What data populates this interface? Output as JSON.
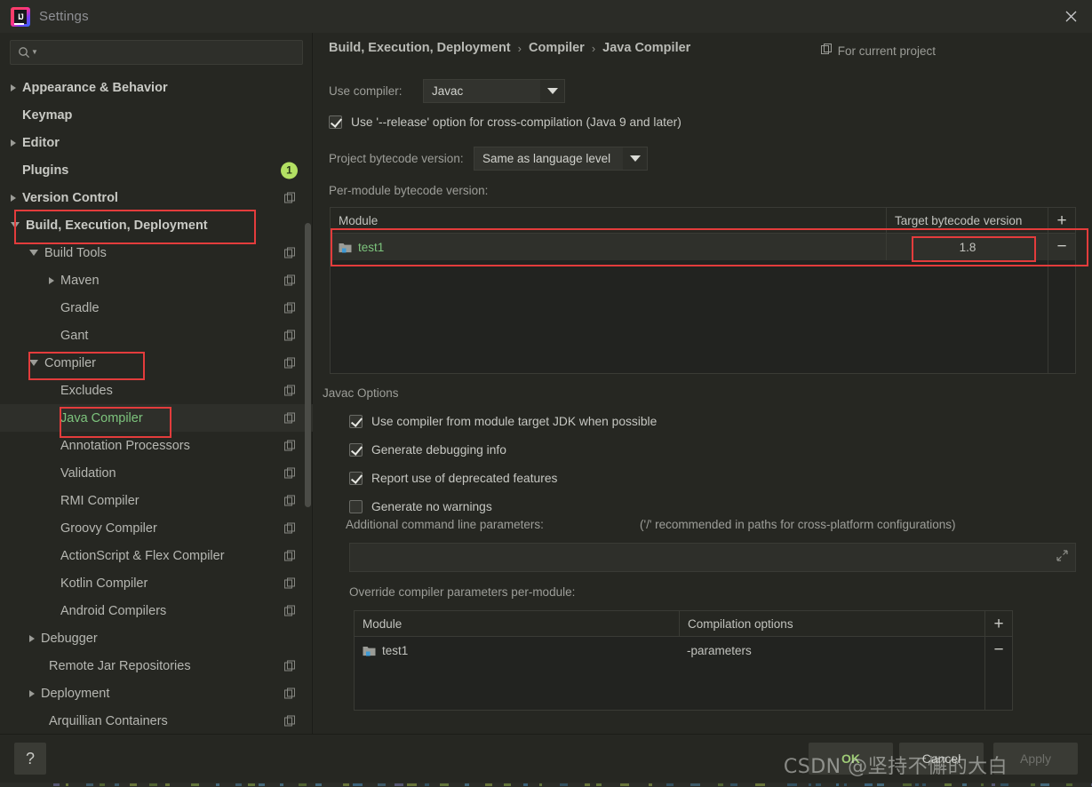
{
  "window": {
    "title": "Settings",
    "logo_text": "IJ",
    "close_icon": "close-icon"
  },
  "search": {
    "value": "",
    "placeholder": ""
  },
  "sidebar": {
    "items": [
      {
        "label": "Appearance & Behavior",
        "indent": 12,
        "twisty": "collapsed",
        "bold": true,
        "icon": "none",
        "selected": false
      },
      {
        "label": "Keymap",
        "indent": 25,
        "twisty": "none",
        "bold": true,
        "icon": "none",
        "selected": false
      },
      {
        "label": "Editor",
        "indent": 12,
        "twisty": "collapsed",
        "bold": true,
        "icon": "none",
        "selected": false
      },
      {
        "label": "Plugins",
        "indent": 25,
        "twisty": "none",
        "bold": true,
        "icon": "badge",
        "badge": "1",
        "selected": false
      },
      {
        "label": "Version Control",
        "indent": 12,
        "twisty": "collapsed",
        "bold": true,
        "icon": "copy-icon",
        "selected": false
      },
      {
        "label": "Build, Execution, Deployment",
        "indent": 12,
        "twisty": "expanded",
        "bold": true,
        "icon": "none",
        "selected": false
      },
      {
        "label": "Build Tools",
        "indent": 33,
        "twisty": "expanded",
        "bold": false,
        "icon": "copy-icon",
        "selected": false
      },
      {
        "label": "Maven",
        "indent": 55,
        "twisty": "collapsed",
        "bold": false,
        "icon": "copy-icon",
        "selected": false
      },
      {
        "label": "Gradle",
        "indent": 68,
        "twisty": "none",
        "bold": false,
        "icon": "copy-icon",
        "selected": false
      },
      {
        "label": "Gant",
        "indent": 68,
        "twisty": "none",
        "bold": false,
        "icon": "copy-icon",
        "selected": false
      },
      {
        "label": "Compiler",
        "indent": 33,
        "twisty": "expanded",
        "bold": false,
        "icon": "copy-icon",
        "selected": false
      },
      {
        "label": "Excludes",
        "indent": 68,
        "twisty": "none",
        "bold": false,
        "icon": "copy-icon",
        "selected": false
      },
      {
        "label": "Java Compiler",
        "indent": 68,
        "twisty": "none",
        "bold": false,
        "icon": "copy-icon",
        "selected": true,
        "green": true
      },
      {
        "label": "Annotation Processors",
        "indent": 68,
        "twisty": "none",
        "bold": false,
        "icon": "copy-icon",
        "selected": false
      },
      {
        "label": "Validation",
        "indent": 68,
        "twisty": "none",
        "bold": false,
        "icon": "copy-icon",
        "selected": false
      },
      {
        "label": "RMI Compiler",
        "indent": 68,
        "twisty": "none",
        "bold": false,
        "icon": "copy-icon",
        "selected": false
      },
      {
        "label": "Groovy Compiler",
        "indent": 68,
        "twisty": "none",
        "bold": false,
        "icon": "copy-icon",
        "selected": false
      },
      {
        "label": "ActionScript & Flex Compiler",
        "indent": 68,
        "twisty": "none",
        "bold": false,
        "icon": "copy-icon",
        "selected": false
      },
      {
        "label": "Kotlin Compiler",
        "indent": 68,
        "twisty": "none",
        "bold": false,
        "icon": "copy-icon",
        "selected": false
      },
      {
        "label": "Android Compilers",
        "indent": 68,
        "twisty": "none",
        "bold": false,
        "icon": "copy-icon",
        "selected": false
      },
      {
        "label": "Debugger",
        "indent": 33,
        "twisty": "collapsed",
        "bold": false,
        "icon": "none",
        "selected": false
      },
      {
        "label": "Remote Jar Repositories",
        "indent": 55,
        "twisty": "none",
        "bold": false,
        "icon": "copy-icon",
        "selected": false
      },
      {
        "label": "Deployment",
        "indent": 33,
        "twisty": "collapsed",
        "bold": false,
        "icon": "copy-icon",
        "selected": false
      },
      {
        "label": "Arquillian Containers",
        "indent": 55,
        "twisty": "none",
        "bold": false,
        "icon": "copy-icon",
        "selected": false
      }
    ]
  },
  "header": {
    "breadcrumb": [
      "Build, Execution, Deployment",
      "Compiler",
      "Java Compiler"
    ],
    "separator": "›",
    "for_project_label": "For current project"
  },
  "compiler": {
    "use_compiler_label": "Use compiler:",
    "use_compiler_value": "Javac",
    "release_option_label": "Use '--release' option for cross-compilation (Java 9 and later)",
    "release_option_checked": true,
    "project_bytecode_label": "Project bytecode version:",
    "project_bytecode_value": "Same as language level",
    "per_module_label": "Per-module bytecode version:"
  },
  "bytecode_table": {
    "columns": [
      "Module",
      "Target bytecode version"
    ],
    "rows": [
      {
        "module": "test1",
        "target": "1.8",
        "selected": true
      }
    ],
    "add_label": "+",
    "remove_label": "−"
  },
  "javac": {
    "section_title": "Javac Options",
    "options": [
      {
        "label": "Use compiler from module target JDK when possible",
        "checked": true
      },
      {
        "label": "Generate debugging info",
        "checked": true
      },
      {
        "label": "Report use of deprecated features",
        "checked": true
      },
      {
        "label": "Generate no warnings",
        "checked": false
      }
    ],
    "additional_params_label": "Additional command line parameters:",
    "additional_params_hint": "('/' recommended in paths for cross-platform configurations)",
    "additional_params_value": "",
    "expand_icon": "expand-icon"
  },
  "override_table": {
    "title": "Override compiler parameters per-module:",
    "columns": [
      "Module",
      "Compilation options"
    ],
    "rows": [
      {
        "module": "test1",
        "options": "-parameters"
      }
    ],
    "add_label": "+",
    "remove_label": "−"
  },
  "footer": {
    "help_label": "?",
    "ok_label": "OK",
    "cancel_label": "Cancel",
    "apply_label": "Apply"
  },
  "watermark": {
    "text": "CSDN @坚持不懈的大白"
  },
  "colors": {
    "accent_green": "#7dc47d",
    "annotation_red": "#e33c3c",
    "badge_green": "#b3e063",
    "window_bg": "#262722",
    "titlebar_bg": "#2b2c27"
  }
}
